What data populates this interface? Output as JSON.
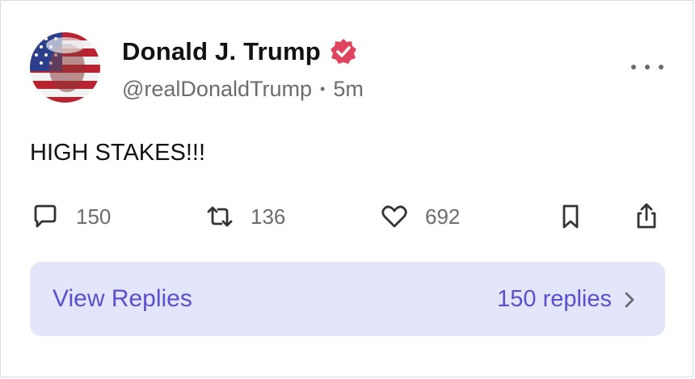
{
  "post": {
    "author_name": "Donald J. Trump",
    "handle": "@realDonaldTrump",
    "separator": "•",
    "time_ago": "5m",
    "text": "HIGH STAKES!!!",
    "verified_icon": "verified-badge-icon",
    "more_icon": "more-options-icon"
  },
  "actions": {
    "reply_count": "150",
    "repost_count": "136",
    "like_count": "692",
    "icons": [
      "reply-icon",
      "repost-icon",
      "like-icon",
      "bookmark-icon",
      "share-icon"
    ]
  },
  "replies": {
    "label": "View Replies",
    "count_text": "150 replies"
  },
  "colors": {
    "accent": "#5a4fcf",
    "replies_bg": "#e3e6fa",
    "verified": "#e0455f",
    "muted": "#6b6b73"
  }
}
